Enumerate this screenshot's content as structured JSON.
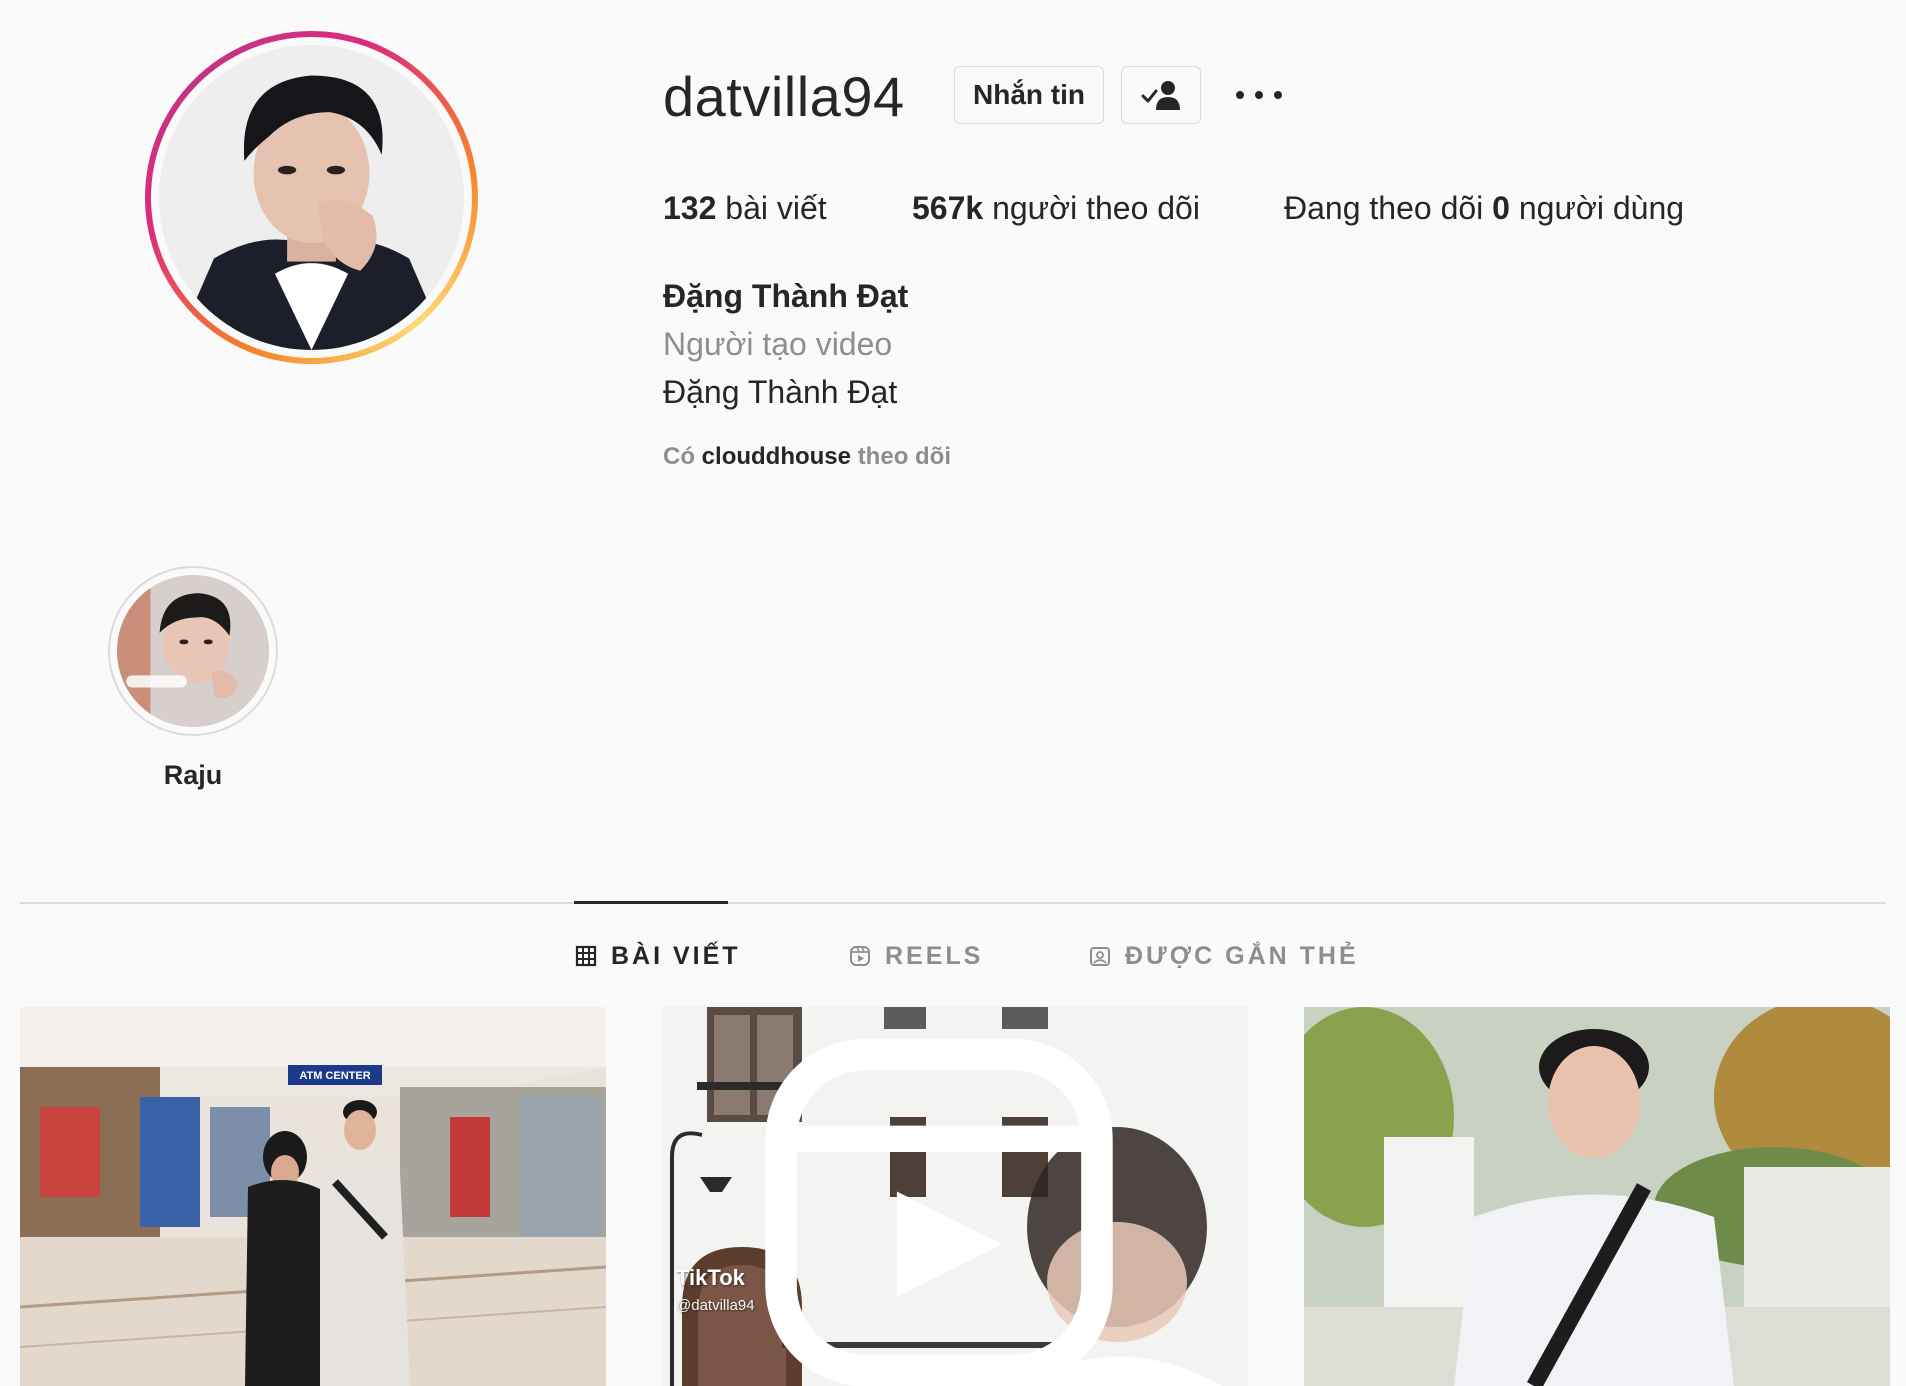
{
  "profile": {
    "username": "datvilla94",
    "message_label": "Nhắn tin",
    "stats": {
      "posts_count": "132",
      "posts_label": "bài viết",
      "followers_count": "567k",
      "followers_label": "người theo dõi",
      "following_prefix": "Đang theo dõi",
      "following_count": "0",
      "following_suffix": "người dùng"
    },
    "full_name": "Đặng Thành Đạt",
    "category": "Người tạo video",
    "bio": "Đặng Thành Đạt",
    "followed_by": {
      "prefix": "Có",
      "name": "clouddhouse",
      "suffix": "theo dõi"
    }
  },
  "highlights": [
    {
      "label": "Raju"
    }
  ],
  "tabs": [
    {
      "label": "BÀI VIẾT",
      "icon": "grid-icon",
      "active": true
    },
    {
      "label": "REELS",
      "icon": "reels-icon",
      "active": false
    },
    {
      "label": "ĐƯỢC GẮN THẺ",
      "icon": "tagged-icon",
      "active": false
    }
  ],
  "posts": [
    {
      "type": "photo",
      "sign_text": "ATM CENTER"
    },
    {
      "type": "reel",
      "watermark": "TikTok",
      "watermark_user": "@datvilla94"
    },
    {
      "type": "photo"
    }
  ],
  "colors": {
    "background": "#fafafa",
    "text": "#262626",
    "secondary_text": "#8e8e8e",
    "border": "#dbdbdb",
    "story_ring_start": "#f58529",
    "story_ring_end": "#dd2a7b"
  }
}
